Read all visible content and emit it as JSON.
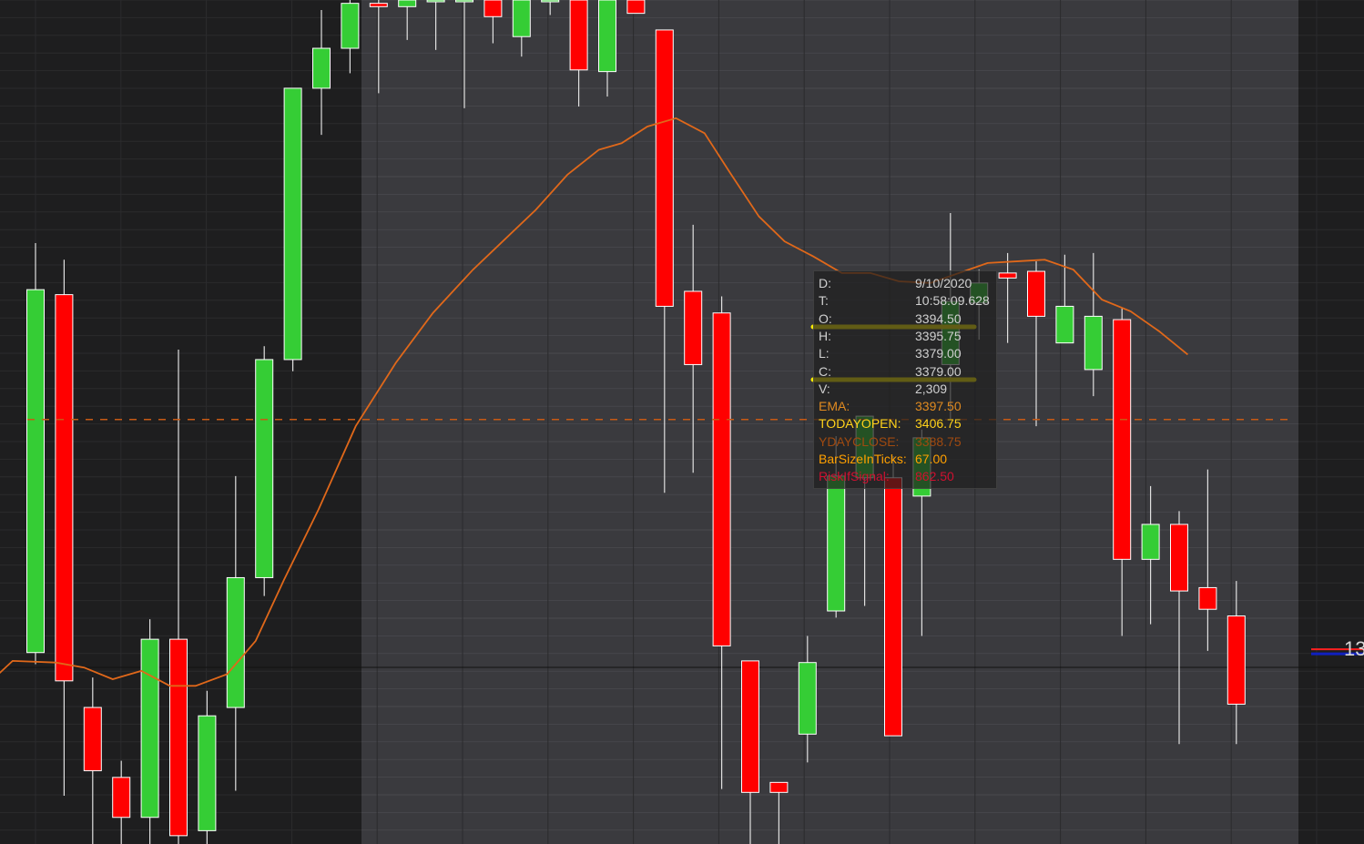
{
  "colors": {
    "background": "#1e1e1f",
    "session_band": "#3a3a3e",
    "grid": "#2b2b2d",
    "grid_band": "#49494e",
    "up": "#35cd35",
    "down": "#ff0000",
    "wick": "#e0e0e0",
    "ema": "#e0681a",
    "yday_close_line": "#c85a14",
    "highlight": "#ffee00"
  },
  "price_tag": {
    "text": "13"
  },
  "tooltip": {
    "rows": [
      {
        "label": "D:",
        "value": "9/10/2020",
        "color": "#d0d0d0"
      },
      {
        "label": "T:",
        "value": "10:58:09.628",
        "color": "#d0d0d0"
      },
      {
        "label": "O:",
        "value": "3394.50",
        "color": "#d0d0d0"
      },
      {
        "label": "H:",
        "value": "3395.75",
        "color": "#d0d0d0"
      },
      {
        "label": "L:",
        "value": "3379.00",
        "color": "#d0d0d0"
      },
      {
        "label": "C:",
        "value": "3379.00",
        "color": "#d0d0d0"
      },
      {
        "label": "V:",
        "value": "2,309",
        "color": "#d0d0d0"
      },
      {
        "label": "EMA:",
        "value": "3397.50",
        "color": "#e08a20"
      },
      {
        "label": "TODAYOPEN:",
        "value": "3406.75",
        "color": "#ffd21a"
      },
      {
        "label": "YDAYCLOSE:",
        "value": "3388.75",
        "color": "#a04a10"
      },
      {
        "label": "BarSizeInTicks:",
        "value": "67.00",
        "color": "#ffa000"
      },
      {
        "label": "RiskIfSignal:",
        "value": "862.50",
        "color": "#d01030"
      }
    ]
  },
  "chart_data": {
    "type": "candlestick",
    "ylim": [
      3372.5,
      3423.2
    ],
    "yday_close": 3398.0,
    "last_price": 3384.2,
    "candles": [
      {
        "x": 1,
        "o": 3384.0,
        "h": 3408.6,
        "l": 3383.3,
        "c": 3405.8
      },
      {
        "x": 2,
        "o": 3405.5,
        "h": 3407.6,
        "l": 3375.4,
        "c": 3382.3
      },
      {
        "x": 3,
        "o": 3380.7,
        "h": 3382.5,
        "l": 3372.5,
        "c": 3376.9
      },
      {
        "x": 4,
        "o": 3376.5,
        "h": 3377.5,
        "l": 3372.5,
        "c": 3374.1
      },
      {
        "x": 5,
        "o": 3374.1,
        "h": 3386.0,
        "l": 3372.5,
        "c": 3384.8
      },
      {
        "x": 6,
        "o": 3384.8,
        "h": 3402.2,
        "l": 3372.5,
        "c": 3373.0
      },
      {
        "x": 7,
        "o": 3373.3,
        "h": 3381.7,
        "l": 3372.5,
        "c": 3380.2
      },
      {
        "x": 8,
        "o": 3380.7,
        "h": 3394.6,
        "l": 3375.7,
        "c": 3388.5
      },
      {
        "x": 9,
        "o": 3388.5,
        "h": 3402.4,
        "l": 3387.4,
        "c": 3401.6
      },
      {
        "x": 10,
        "o": 3401.6,
        "h": 3414.3,
        "l": 3400.9,
        "c": 3417.9
      },
      {
        "x": 11,
        "o": 3417.9,
        "h": 3422.6,
        "l": 3415.1,
        "c": 3420.3
      },
      {
        "x": 12,
        "o": 3420.3,
        "h": 3423.2,
        "l": 3418.8,
        "c": 3423.0
      },
      {
        "x": 13,
        "o": 3423.0,
        "h": 3423.2,
        "l": 3417.6,
        "c": 3422.8
      },
      {
        "x": 14,
        "o": 3422.8,
        "h": 3423.2,
        "l": 3420.8,
        "c": 3423.2
      },
      {
        "x": 15,
        "o": 3423.2,
        "h": 3423.2,
        "l": 3420.2,
        "c": 3423.2
      },
      {
        "x": 16,
        "o": 3423.2,
        "h": 3423.2,
        "l": 3416.7,
        "c": 3423.2
      },
      {
        "x": 17,
        "o": 3423.2,
        "h": 3423.2,
        "l": 3420.6,
        "c": 3422.2
      },
      {
        "x": 18,
        "o": 3421.0,
        "h": 3423.2,
        "l": 3419.8,
        "c": 3423.2
      },
      {
        "x": 19,
        "o": 3423.2,
        "h": 3423.2,
        "l": 3422.3,
        "c": 3423.2
      },
      {
        "x": 20,
        "o": 3423.2,
        "h": 3423.2,
        "l": 3416.8,
        "c": 3419.0
      },
      {
        "x": 21,
        "o": 3418.9,
        "h": 3423.2,
        "l": 3417.4,
        "c": 3423.2
      },
      {
        "x": 22,
        "o": 3423.2,
        "h": 3423.2,
        "l": 3422.4,
        "c": 3422.4
      },
      {
        "x": 23,
        "o": 3421.4,
        "h": 3421.4,
        "l": 3393.6,
        "c": 3404.8
      },
      {
        "x": 24,
        "o": 3405.7,
        "h": 3409.7,
        "l": 3394.8,
        "c": 3401.3
      },
      {
        "x": 25,
        "o": 3404.4,
        "h": 3405.4,
        "l": 3375.8,
        "c": 3384.4
      },
      {
        "x": 26,
        "o": 3383.5,
        "h": 3383.5,
        "l": 3372.5,
        "c": 3375.6
      },
      {
        "x": 27,
        "o": 3376.2,
        "h": 3376.2,
        "l": 3372.5,
        "c": 3375.6
      },
      {
        "x": 28,
        "o": 3379.1,
        "h": 3385.0,
        "l": 3377.4,
        "c": 3383.4
      },
      {
        "x": 29,
        "o": 3386.5,
        "h": 3397.0,
        "l": 3386.1,
        "c": 3394.6
      },
      {
        "x": 30,
        "o": 3394.5,
        "h": 3395.8,
        "l": 3386.8,
        "c": 3398.2
      },
      {
        "x": 31,
        "o": 3394.5,
        "h": 3395.8,
        "l": 3379.0,
        "c": 3379.0
      },
      {
        "x": 32,
        "o": 3393.4,
        "h": 3397.4,
        "l": 3385.0,
        "c": 3396.9
      },
      {
        "x": 33,
        "o": 3401.3,
        "h": 3410.4,
        "l": 3398.0,
        "c": 3405.1
      },
      {
        "x": 34,
        "o": 3405.0,
        "h": 3407.0,
        "l": 3402.8,
        "c": 3406.2
      },
      {
        "x": 35,
        "o": 3406.8,
        "h": 3408.0,
        "l": 3402.6,
        "c": 3406.5
      },
      {
        "x": 36,
        "o": 3406.9,
        "h": 3407.5,
        "l": 3397.6,
        "c": 3404.2
      },
      {
        "x": 37,
        "o": 3402.6,
        "h": 3407.9,
        "l": 3403.6,
        "c": 3404.8
      },
      {
        "x": 38,
        "o": 3401.0,
        "h": 3408.0,
        "l": 3399.4,
        "c": 3404.2
      },
      {
        "x": 39,
        "o": 3404.0,
        "h": 3404.7,
        "l": 3385.0,
        "c": 3389.6
      },
      {
        "x": 40,
        "o": 3389.6,
        "h": 3394.0,
        "l": 3385.7,
        "c": 3391.7
      },
      {
        "x": 41,
        "o": 3391.7,
        "h": 3392.5,
        "l": 3378.5,
        "c": 3387.7
      },
      {
        "x": 42,
        "o": 3387.9,
        "h": 3395.0,
        "l": 3384.1,
        "c": 3386.6
      },
      {
        "x": 43,
        "o": 3386.2,
        "h": 3388.3,
        "l": 3378.5,
        "c": 3380.9
      }
    ],
    "ema": [
      [
        -0.3,
        3382.7
      ],
      [
        0.2,
        3383.5
      ],
      [
        1.7,
        3383.4
      ],
      [
        2.7,
        3383.1
      ],
      [
        3.7,
        3382.4
      ],
      [
        4.7,
        3382.9
      ],
      [
        5.7,
        3382.0
      ],
      [
        6.6,
        3382.0
      ],
      [
        7.7,
        3382.7
      ],
      [
        8.7,
        3384.7
      ],
      [
        9.7,
        3388.4
      ],
      [
        10.9,
        3392.6
      ],
      [
        12.2,
        3397.6
      ],
      [
        13.6,
        3401.4
      ],
      [
        14.9,
        3404.4
      ],
      [
        16.3,
        3407.0
      ],
      [
        17.4,
        3408.8
      ],
      [
        18.5,
        3410.6
      ],
      [
        19.6,
        3412.7
      ],
      [
        20.7,
        3414.2
      ],
      [
        21.5,
        3414.6
      ],
      [
        22.4,
        3415.6
      ],
      [
        23.4,
        3416.1
      ],
      [
        24.4,
        3415.2
      ],
      [
        25.3,
        3412.8
      ],
      [
        26.3,
        3410.2
      ],
      [
        27.2,
        3408.7
      ],
      [
        28.2,
        3407.8
      ],
      [
        29.2,
        3406.8
      ],
      [
        30.2,
        3406.8
      ],
      [
        31.2,
        3406.3
      ],
      [
        32.3,
        3406.2
      ],
      [
        33.3,
        3406.8
      ],
      [
        34.3,
        3407.4
      ],
      [
        35.3,
        3407.5
      ],
      [
        36.3,
        3407.6
      ],
      [
        37.3,
        3407.0
      ],
      [
        38.3,
        3405.2
      ],
      [
        39.3,
        3404.5
      ],
      [
        40.3,
        3403.3
      ],
      [
        41.3,
        3401.9
      ]
    ]
  }
}
